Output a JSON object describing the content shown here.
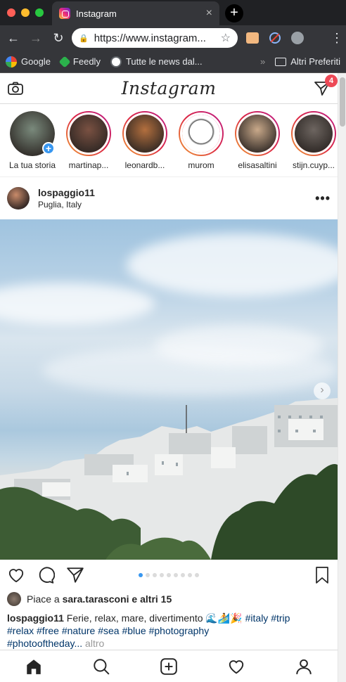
{
  "browser": {
    "tab_title": "Instagram",
    "tab_close": "×",
    "new_tab": "+",
    "url": "https://www.instagram...",
    "bookmarks": [
      {
        "label": "Google",
        "icon": "google-icon"
      },
      {
        "label": "Feedly",
        "icon": "feedly-icon"
      },
      {
        "label": "Tutte le news dal...",
        "icon": "news-icon"
      }
    ],
    "bookmarks_overflow": "»",
    "other_bookmarks": "Altri Preferiti"
  },
  "header": {
    "logo": "Instagram",
    "notification_count": "4"
  },
  "stories": [
    {
      "name": "La tua storia",
      "own": true,
      "color": "#7a8a7c"
    },
    {
      "name": "martinap...",
      "color": "#7a5142"
    },
    {
      "name": "leonardb...",
      "color": "#b36f3e"
    },
    {
      "name": "murom",
      "color": "#ffffff"
    },
    {
      "name": "elisasaltini",
      "color": "#c9a98a"
    },
    {
      "name": "stijn.cuyp...",
      "color": "#6d6560"
    }
  ],
  "post": {
    "username": "lospaggio11",
    "location": "Puglia, Italy",
    "options": "•••",
    "next_arrow": "›",
    "liked_by_prefix": "Piace a ",
    "liked_by_user": "sara.tarasconi",
    "liked_by_suffix": " e altri 15",
    "caption_user": "lospaggio11",
    "caption_text": " Ferie, relax, mare, divertimento 🌊🏄🎉 ",
    "hashtags_line1": "#italy #trip",
    "hashtags_line2": "#relax #free #nature #sea #blue #photography",
    "hashtags_line3": "#photooftheday...",
    "more": " altro",
    "carousel_count": 9,
    "carousel_active": 0
  },
  "colors": {
    "accent": "#3897f0",
    "badge": "#ed4956",
    "hashtag": "#003569"
  }
}
